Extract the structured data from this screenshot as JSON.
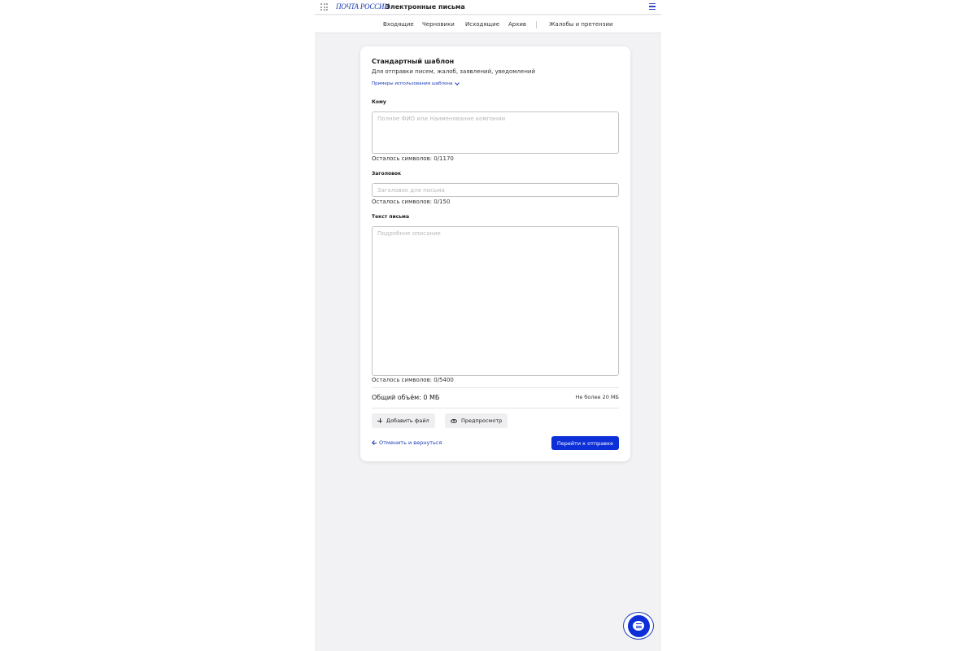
{
  "header": {
    "logo": "ПОЧТА РОССИИ",
    "title": "Электронные письма",
    "apps_icon": "grid-icon",
    "menu_icon": "hamburger-menu-icon"
  },
  "tabs": [
    {
      "label": "Входящие"
    },
    {
      "label": "Черновики"
    },
    {
      "label": "Исходящие"
    },
    {
      "label": "Архив"
    },
    {
      "label": "Жалобы и претензии"
    }
  ],
  "form": {
    "title": "Стандартный шаблон",
    "subtitle": "Для отправки писем, жалоб, заявлений, уведомлений",
    "examples_link": "Примеры использования шаблона",
    "to": {
      "label": "Кому",
      "placeholder": "Полное ФИО или Наименование компании",
      "value": "",
      "counter": "Осталось символов: 0/1170"
    },
    "subject": {
      "label": "Заголовок",
      "placeholder": "Заголовок для письма",
      "value": "",
      "counter": "Осталось символов: 0/150"
    },
    "body": {
      "label": "Текст письма",
      "placeholder": "Подробное описание",
      "value": "",
      "counter": "Осталось символов: 0/5400"
    },
    "total_size": "Общий объём: 0 МБ",
    "size_limit": "Не более 20 МБ",
    "add_file_label": "Добавить файл",
    "preview_label": "Предпросмотр",
    "cancel_label": "Отменить и вернуться",
    "submit_label": "Перейти к отправке"
  },
  "colors": {
    "accent": "#0d2fd8",
    "link": "#1b3bb5",
    "page_bg": "#f2f2f4"
  },
  "chat": {
    "icon": "chat-icon"
  }
}
